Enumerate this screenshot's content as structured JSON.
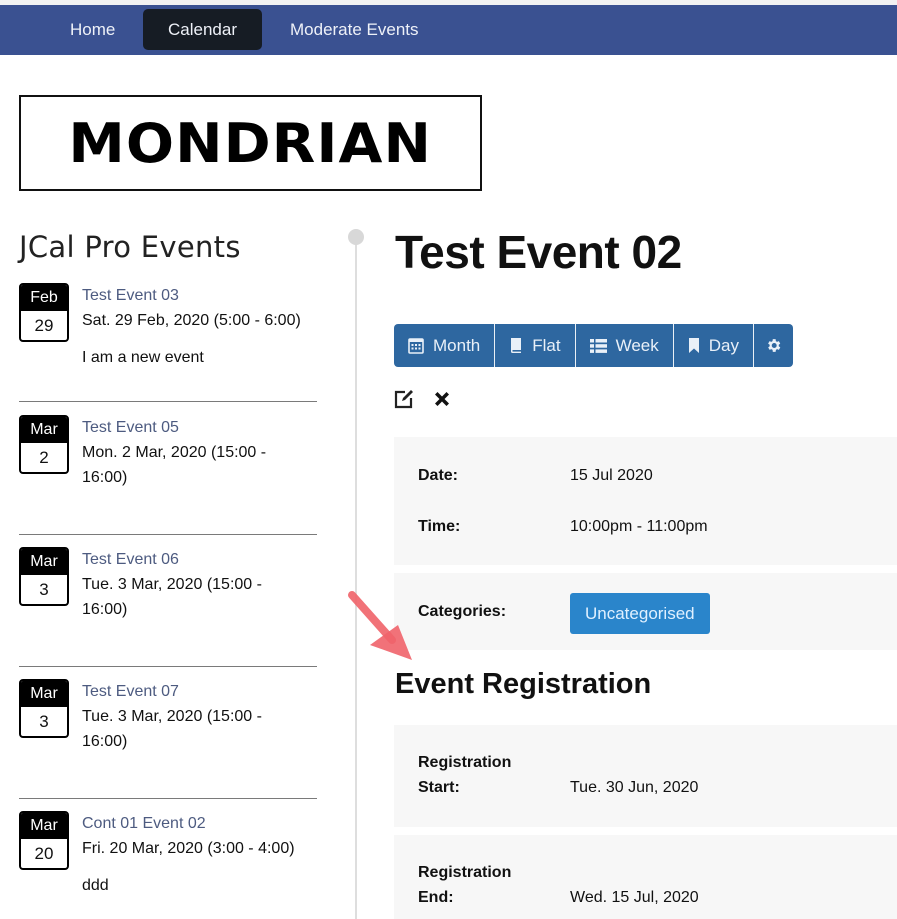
{
  "nav": {
    "items": [
      {
        "label": "Home",
        "active": false
      },
      {
        "label": "Calendar",
        "active": true
      },
      {
        "label": "Moderate Events",
        "active": false
      }
    ],
    "bg_color": "#3a5191",
    "active_color": "#161c24"
  },
  "logo": {
    "text": "MONDRIAN"
  },
  "sidebar": {
    "title": "JCal Pro Events",
    "events": [
      {
        "month": "Feb",
        "day": "29",
        "title": "Test Event 03",
        "when": "Sat. 29 Feb, 2020 (5:00 - 6:00)",
        "desc": "I am a new event"
      },
      {
        "month": "Mar",
        "day": "2",
        "title": "Test Event 05",
        "when": "Mon. 2 Mar, 2020 (15:00 - 16:00)",
        "desc": ""
      },
      {
        "month": "Mar",
        "day": "3",
        "title": "Test Event 06",
        "when": "Tue. 3 Mar, 2020 (15:00 - 16:00)",
        "desc": ""
      },
      {
        "month": "Mar",
        "day": "3",
        "title": "Test Event 07",
        "when": "Tue. 3 Mar, 2020 (15:00 - 16:00)",
        "desc": ""
      },
      {
        "month": "Mar",
        "day": "20",
        "title": "Cont 01 Event 02",
        "when": "Fri. 20 Mar, 2020 (3:00 - 4:00)",
        "desc": "ddd"
      }
    ]
  },
  "main": {
    "title": "Test Event 02",
    "view_buttons": [
      {
        "label": "Month",
        "icon": "calendar-icon"
      },
      {
        "label": "Flat",
        "icon": "book-icon"
      },
      {
        "label": "Week",
        "icon": "list-icon"
      },
      {
        "label": "Day",
        "icon": "bookmark-icon"
      },
      {
        "label": "",
        "icon": "gear-icon"
      }
    ],
    "actions": [
      {
        "icon": "edit-icon"
      },
      {
        "icon": "delete-icon"
      }
    ],
    "details": {
      "date_label": "Date:",
      "date_value": "15 Jul 2020",
      "time_label": "Time:",
      "time_value": "10:00pm - 11:00pm",
      "categories_label": "Categories:",
      "category": "Uncategorised"
    },
    "registration": {
      "title": "Event Registration",
      "start_label_1": "Registration",
      "start_label_2": "Start:",
      "start_value": "Tue. 30 Jun, 2020",
      "end_label_1": "Registration",
      "end_label_2": "End:",
      "end_value": "Wed. 15 Jul, 2020"
    }
  },
  "colors": {
    "button_blue": "#2e67a0",
    "category_blue": "#2a85cb",
    "link_color": "#4d5b80",
    "annotation_arrow": "#f0636a"
  }
}
